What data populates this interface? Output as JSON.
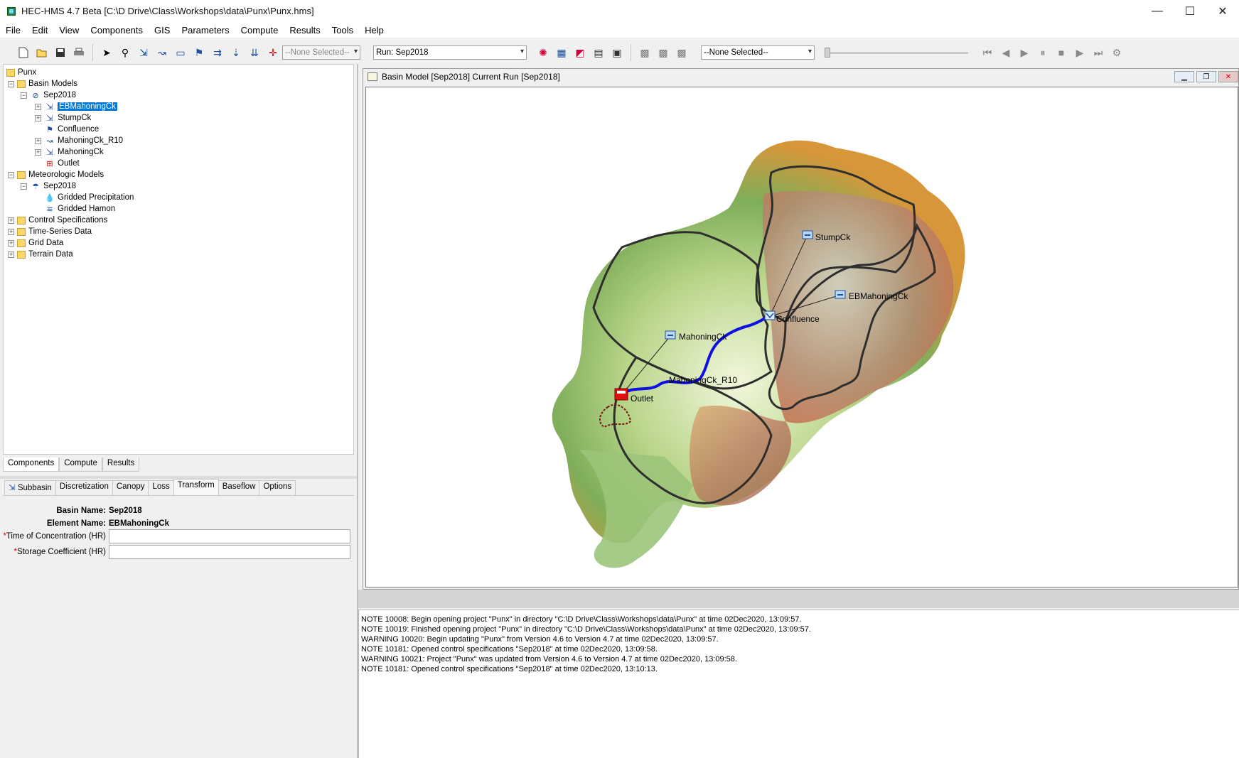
{
  "window": {
    "title": "HEC-HMS 4.7 Beta [C:\\D Drive\\Class\\Workshops\\data\\Punx\\Punx.hms]",
    "min": "—",
    "max": "☐",
    "close": "✕"
  },
  "menu": [
    "File",
    "Edit",
    "View",
    "Components",
    "GIS",
    "Parameters",
    "Compute",
    "Results",
    "Tools",
    "Help"
  ],
  "toolbar": {
    "element_select": "--None Selected--",
    "run_select": "Run: Sep2018",
    "results_select": "--None Selected--"
  },
  "tree": {
    "root": "Punx",
    "basin_models": "Basin Models",
    "basin": "Sep2018",
    "elements": [
      "EBMahoningCk",
      "StumpCk",
      "Confluence",
      "MahoningCk_R10",
      "MahoningCk",
      "Outlet"
    ],
    "met_models": "Meteorologic Models",
    "met": "Sep2018",
    "met_items": [
      "Gridded Precipitation",
      "Gridded Hamon"
    ],
    "folders": [
      "Control Specifications",
      "Time-Series Data",
      "Grid Data",
      "Terrain Data"
    ]
  },
  "panel_tabs": [
    "Components",
    "Compute",
    "Results"
  ],
  "editor_tabs": [
    "Subbasin",
    "Discretization",
    "Canopy",
    "Loss",
    "Transform",
    "Baseflow",
    "Options"
  ],
  "editor": {
    "basin_label": "Basin Name:",
    "basin_value": "Sep2018",
    "element_label": "Element Name:",
    "element_value": "EBMahoningCk",
    "req_mark": "*",
    "toc_label": "Time of Concentration (HR)",
    "storage_label": "Storage Coefficient (HR)",
    "toc_value": "",
    "storage_value": ""
  },
  "map": {
    "title": "Basin Model [Sep2018] Current Run [Sep2018]",
    "labels": {
      "stump": "StumpCk",
      "eb": "EBMahoningCk",
      "confluence": "Confluence",
      "mahoning": "MahoningCk",
      "reach": "MahoningCk_R10",
      "outlet": "Outlet"
    }
  },
  "log": [
    "NOTE 10008:  Begin opening project \"Punx\" in directory \"C:\\D Drive\\Class\\Workshops\\data\\Punx\" at time 02Dec2020, 13:09:57.",
    "NOTE 10019:  Finished opening project \"Punx\" in directory \"C:\\D Drive\\Class\\Workshops\\data\\Punx\" at time 02Dec2020, 13:09:57.",
    "WARNING 10020:  Begin updating \"Punx\" from Version 4.6 to Version 4.7 at time 02Dec2020, 13:09:57.",
    "NOTE 10181:  Opened control specifications \"Sep2018\" at time 02Dec2020, 13:09:58.",
    "WARNING 10021:  Project \"Punx\" was updated from Version 4.6 to Version 4.7 at time 02Dec2020, 13:09:58.",
    "NOTE 10181:  Opened control specifications \"Sep2018\" at time 02Dec2020, 13:10:13."
  ],
  "colors": {
    "selection": "#0078d7",
    "reach": "#1010e0",
    "outlet": "#e01010"
  }
}
